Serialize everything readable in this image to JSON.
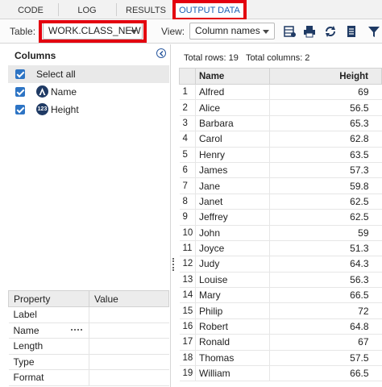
{
  "tabs": [
    {
      "label": "CODE"
    },
    {
      "label": "LOG"
    },
    {
      "label": "RESULTS"
    },
    {
      "label": "OUTPUT DATA"
    }
  ],
  "toolbar": {
    "table_label": "Table:",
    "table_value": "WORK.CLASS_NEW",
    "view_label": "View:",
    "view_value": "Column names",
    "icons": [
      "data-grid-icon",
      "print-icon",
      "refresh-icon",
      "export-icon",
      "filter-icon"
    ]
  },
  "highlight_color": "#e3000f",
  "accent_color": "#1a5fb4",
  "columns_panel": {
    "title": "Columns",
    "select_all": "Select all",
    "columns": [
      {
        "name": "Name",
        "type_icon": "character-type-icon"
      },
      {
        "name": "Height",
        "type_icon": "numeric-type-icon",
        "type_label": "123"
      }
    ]
  },
  "properties": {
    "headers": [
      "Property",
      "Value"
    ],
    "rows": [
      "Label",
      "Name",
      "Length",
      "Type",
      "Format"
    ]
  },
  "summary": {
    "rows_text": "Total rows: 19",
    "cols_text": "Total columns: 2"
  },
  "grid": {
    "headers": [
      "Name",
      "Height"
    ],
    "rows": [
      {
        "idx": "1",
        "name": "Alfred",
        "height": "69"
      },
      {
        "idx": "2",
        "name": "Alice",
        "height": "56.5"
      },
      {
        "idx": "3",
        "name": "Barbara",
        "height": "65.3"
      },
      {
        "idx": "4",
        "name": "Carol",
        "height": "62.8"
      },
      {
        "idx": "5",
        "name": "Henry",
        "height": "63.5"
      },
      {
        "idx": "6",
        "name": "James",
        "height": "57.3"
      },
      {
        "idx": "7",
        "name": "Jane",
        "height": "59.8"
      },
      {
        "idx": "8",
        "name": "Janet",
        "height": "62.5"
      },
      {
        "idx": "9",
        "name": "Jeffrey",
        "height": "62.5"
      },
      {
        "idx": "10",
        "name": "John",
        "height": "59"
      },
      {
        "idx": "11",
        "name": "Joyce",
        "height": "51.3"
      },
      {
        "idx": "12",
        "name": "Judy",
        "height": "64.3"
      },
      {
        "idx": "13",
        "name": "Louise",
        "height": "56.3"
      },
      {
        "idx": "14",
        "name": "Mary",
        "height": "66.5"
      },
      {
        "idx": "15",
        "name": "Philip",
        "height": "72"
      },
      {
        "idx": "16",
        "name": "Robert",
        "height": "64.8"
      },
      {
        "idx": "17",
        "name": "Ronald",
        "height": "67"
      },
      {
        "idx": "18",
        "name": "Thomas",
        "height": "57.5"
      },
      {
        "idx": "19",
        "name": "William",
        "height": "66.5"
      }
    ]
  }
}
